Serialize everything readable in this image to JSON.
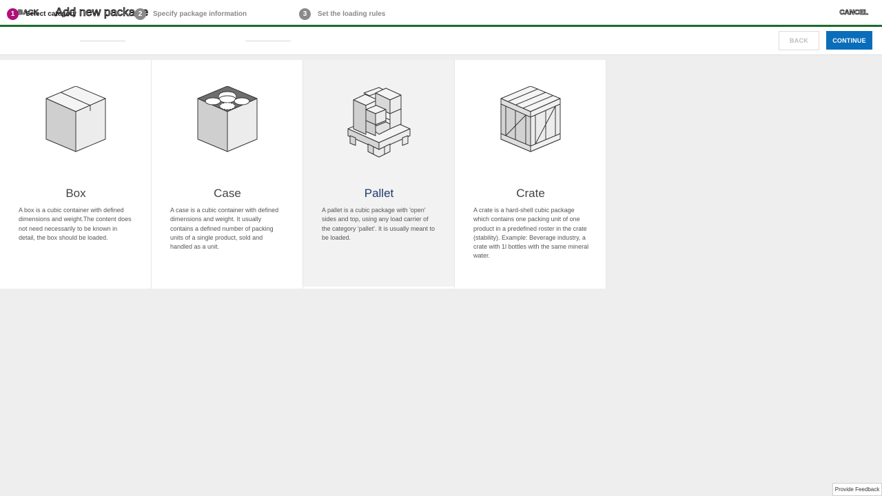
{
  "header": {
    "back_label": "BACK",
    "title": "Add new package",
    "cancel_label": "CANCEL"
  },
  "stepper": {
    "steps": [
      {
        "num": "1",
        "label": "Select category"
      },
      {
        "num": "2",
        "label": "Specify package information"
      },
      {
        "num": "3",
        "label": "Set the loading rules"
      }
    ],
    "back_button": "BACK",
    "continue_button": "CONTINUE"
  },
  "categories": [
    {
      "name": "Box",
      "icon": "box-icon",
      "description": "A box is a cubic container with defined dimensions and weight.The content does not need necessarily to be known in detail, the box should be loaded."
    },
    {
      "name": "Case",
      "icon": "case-icon",
      "description": "A case is a cubic container with defined dimensions and weight. It usually contains a defined number of packing units of a single product, sold and handled as a unit."
    },
    {
      "name": "Pallet",
      "icon": "pallet-icon",
      "description": "A pallet is a cubic package with 'open' sides and top, using any load carrier of the category 'pallet'. It is usually meant to be loaded."
    },
    {
      "name": "Crate",
      "icon": "crate-icon",
      "description": "A crate is a hard-shell cubic package which contains one packing unit of one product in a predefined roster in the crate (stability). Example: Beverage industry, a crate with 1l bottles with the same mineral water."
    }
  ],
  "selected_category": "Pallet",
  "colors": {
    "accent_green": "#1b6b2a",
    "step_active": "#b0107a",
    "primary_button": "#0a6dba",
    "selected_title": "#1d3c68"
  },
  "feedback_label": "Provide Feedback"
}
